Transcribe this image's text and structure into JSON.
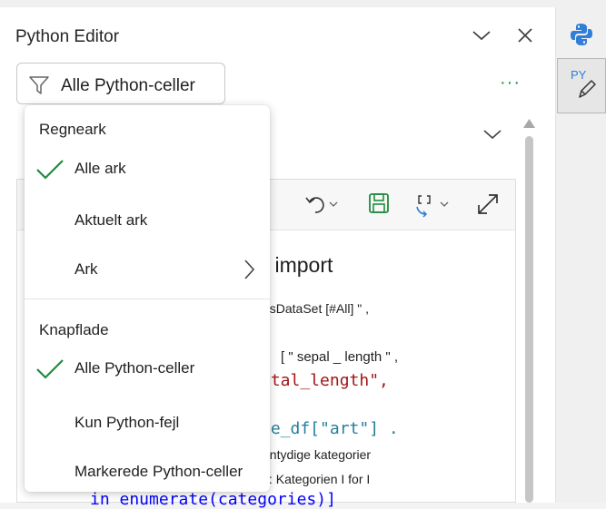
{
  "panel": {
    "title": "Python Editor",
    "filter_value": "Alle Python-celler",
    "more_label": "···"
  },
  "filter_menu": {
    "sections": [
      {
        "heading": "Regneark",
        "items": [
          {
            "label": "Alle ark",
            "checked": true
          },
          {
            "label": "Aktuelt ark",
            "checked": false
          },
          {
            "label": "Ark",
            "checked": false,
            "submenu": true
          }
        ]
      },
      {
        "heading": "Knapflade",
        "items": [
          {
            "label": "Alle Python-celler",
            "checked": true
          },
          {
            "label": "Kun Python-fejl",
            "checked": false
          },
          {
            "label": "Markerede Python-celler",
            "checked": false
          }
        ]
      }
    ]
  },
  "code_cell": {
    "lines": [
      "i import",
      "risDataSet [#All] \" ,",
      "[ \" sepal _ length \" ,",
      "etal_length\",",
      "le_df[\"art\"] .",
      "entydige kategorier",
      "y: Kategorien I for I",
      "in enumerate(categories)]"
    ]
  },
  "rail": {
    "python_icon": "python-logo-icon",
    "py_badge": "PY"
  },
  "colors": {
    "accent_green": "#1e8c3e",
    "python_blue": "#2f7ed8",
    "code_red": "#a31515",
    "code_blue": "#0000ff",
    "code_teal": "#267f99"
  }
}
